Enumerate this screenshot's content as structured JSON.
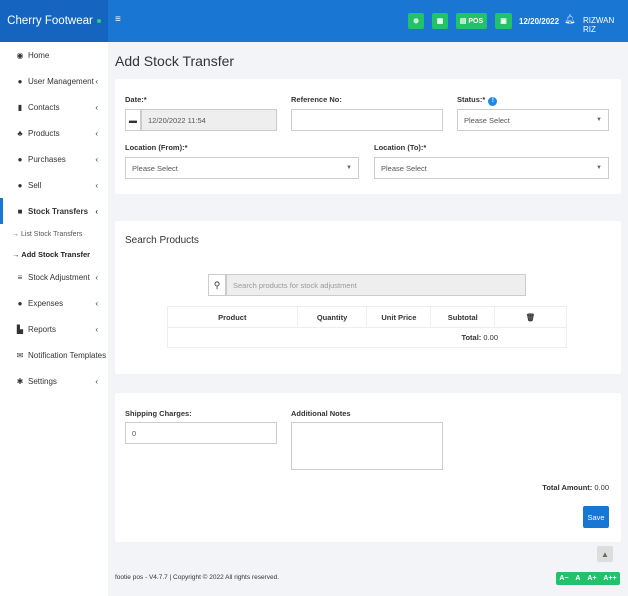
{
  "brand": {
    "name": "Cherry Footwear"
  },
  "topbar": {
    "menu_icon": "≡",
    "pos_label": "POS",
    "date": "12/20/2022",
    "user": "RIZWAN RIZ"
  },
  "sidebar": {
    "items": [
      {
        "icon": "dashboard-icon",
        "glyph": "◉",
        "label": "Home",
        "chev": ""
      },
      {
        "icon": "users-icon",
        "glyph": "●",
        "label": "User Management",
        "chev": "‹"
      },
      {
        "icon": "contacts-icon",
        "glyph": "▮",
        "label": "Contacts",
        "chev": "‹"
      },
      {
        "icon": "cubes-icon",
        "glyph": "♣",
        "label": "Products",
        "chev": "‹"
      },
      {
        "icon": "purchases-icon",
        "glyph": "●",
        "label": "Purchases",
        "chev": "‹"
      },
      {
        "icon": "sell-icon",
        "glyph": "●",
        "label": "Sell",
        "chev": "‹"
      },
      {
        "icon": "truck-icon",
        "glyph": "■",
        "label": "Stock Transfers",
        "chev": "‹"
      },
      {
        "icon": "database-icon",
        "glyph": "≡",
        "label": "Stock Adjustment",
        "chev": "‹"
      },
      {
        "icon": "expenses-icon",
        "glyph": "●",
        "label": "Expenses",
        "chev": "‹"
      },
      {
        "icon": "chart-icon",
        "glyph": "▙",
        "label": "Reports",
        "chev": "‹"
      },
      {
        "icon": "envelope-icon",
        "glyph": "✉",
        "label": "Notification Templates",
        "chev": ""
      },
      {
        "icon": "cog-icon",
        "glyph": "✱",
        "label": "Settings",
        "chev": "‹"
      }
    ],
    "sub": {
      "list": "→ List Stock Transfers",
      "add": "→ Add Stock Transfer"
    }
  },
  "page": {
    "title": "Add Stock Transfer"
  },
  "form": {
    "date_label": "Date:*",
    "date_value": "12/20/2022 11:54",
    "ref_label": "Reference No:",
    "status_label": "Status:*",
    "status_value": "Please Select",
    "from_label": "Location (From):*",
    "from_value": "Please Select",
    "to_label": "Location (To):*",
    "to_value": "Please Select"
  },
  "search": {
    "title": "Search Products",
    "placeholder": "Search products for stock adjustment",
    "columns": [
      "Product",
      "Quantity",
      "Unit Price",
      "Subtotal"
    ],
    "total_label": "Total:",
    "total_value": "0.00"
  },
  "bottom": {
    "shipping_label": "Shipping Charges:",
    "shipping_value": "0",
    "notes_label": "Additional Notes",
    "total_amount_label": "Total Amount:",
    "total_amount_value": "0.00",
    "save_label": "Save"
  },
  "footer": {
    "text": "footie pos - V4.7.7 | Copyright © 2022 All rights reserved."
  },
  "font_controls": [
    "A−",
    "A",
    "A+",
    "A++"
  ]
}
